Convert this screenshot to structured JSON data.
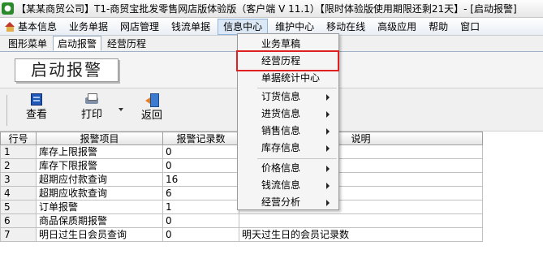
{
  "window": {
    "title": "【某某商贸公司】T1-商贸宝批发零售网店版体验版（客户端 V 11.1）【限时体验版使用期限还剩21天】- [启动报警]"
  },
  "menubar": {
    "items": [
      "基本信息",
      "业务单据",
      "网店管理",
      "钱流单据",
      "信息中心",
      "维护中心",
      "移动在线",
      "高级应用",
      "帮助",
      "窗口"
    ]
  },
  "tabs": [
    "图形菜单",
    "启动报警",
    "经营历程"
  ],
  "header": {
    "label": "启动报警"
  },
  "toolbar": {
    "view": "查看",
    "print": "打印",
    "back": "返回"
  },
  "grid": {
    "columns": [
      "行号",
      "报警项目",
      "报警记录数",
      "说明"
    ],
    "rows": [
      {
        "no": "1",
        "item": "库存上限报警",
        "count": "0",
        "desc": ""
      },
      {
        "no": "2",
        "item": "库存下限报警",
        "count": "0",
        "desc": ""
      },
      {
        "no": "3",
        "item": "超期应付款查询",
        "count": "16",
        "desc": ""
      },
      {
        "no": "4",
        "item": "超期应收款查询",
        "count": "6",
        "desc": ""
      },
      {
        "no": "5",
        "item": "订单报警",
        "count": "1",
        "desc": ""
      },
      {
        "no": "6",
        "item": "商品保质期报警",
        "count": "0",
        "desc": ""
      },
      {
        "no": "7",
        "item": "明日过生日会员查询",
        "count": "0",
        "desc": "明天过生日的会员记录数"
      }
    ]
  },
  "dropdown": {
    "items": [
      {
        "label": "业务草稿",
        "submenu": false
      },
      {
        "label": "经营历程",
        "submenu": false,
        "highlighted": true
      },
      {
        "label": "单据统计中心",
        "submenu": false
      },
      {
        "label": "订货信息",
        "submenu": true
      },
      {
        "label": "进货信息",
        "submenu": true
      },
      {
        "label": "销售信息",
        "submenu": true
      },
      {
        "label": "库存信息",
        "submenu": true
      },
      {
        "label": "价格信息",
        "submenu": true
      },
      {
        "label": "钱流信息",
        "submenu": true
      },
      {
        "label": "经营分析",
        "submenu": true
      }
    ]
  },
  "colors": {
    "highlight_border": "#e02020",
    "active_menu_bg": "#dce8f6"
  }
}
